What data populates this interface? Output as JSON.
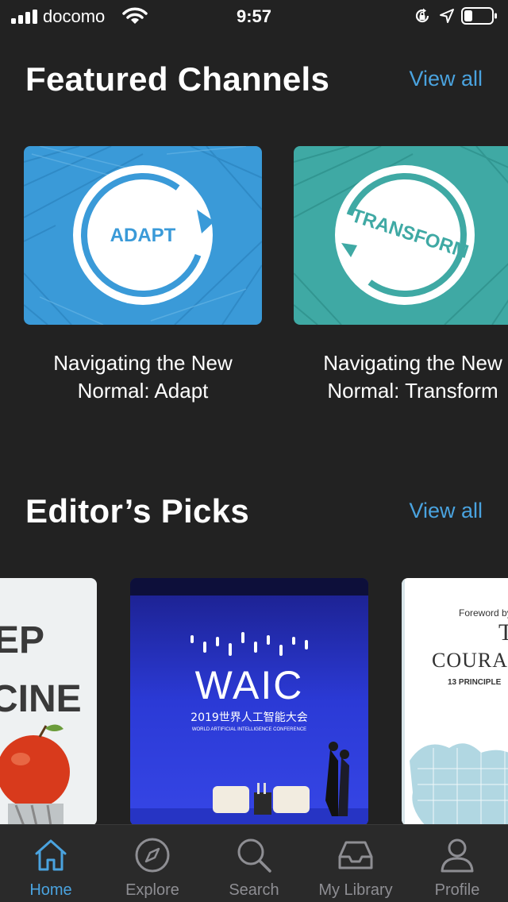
{
  "status_bar": {
    "carrier": "docomo",
    "time": "9:57"
  },
  "featured": {
    "title": "Featured Channels",
    "view_all": "View all",
    "cards": [
      {
        "badge": "ADAPT",
        "title_line1": "Navigating the New",
        "title_line2": "Normal: Adapt",
        "color": "#3a9ad8"
      },
      {
        "badge": "TRANSFORM",
        "title_line1": "Navigating the New",
        "title_line2": "Normal: Transform",
        "color": "#3fa9a4"
      }
    ]
  },
  "editors_picks": {
    "title": "Editor’s Picks",
    "view_all": "View all",
    "items": [
      {
        "visible_text_1": "EP",
        "visible_text_2": "CINE"
      },
      {
        "logo": "WAIC",
        "subtitle": "2019世界人工智能大会",
        "caption": "WORLD ARTIFICIAL INTELLIGENCE CONFERENCE"
      },
      {
        "foreword": "Foreword by",
        "letter": "T",
        "word": "COURA",
        "sub": "13 PRINCIPLE"
      }
    ]
  },
  "tabs": [
    {
      "label": "Home",
      "icon": "home-icon",
      "active": true
    },
    {
      "label": "Explore",
      "icon": "compass-icon",
      "active": false
    },
    {
      "label": "Search",
      "icon": "search-icon",
      "active": false
    },
    {
      "label": "My Library",
      "icon": "inbox-icon",
      "active": false
    },
    {
      "label": "Profile",
      "icon": "person-icon",
      "active": false
    }
  ],
  "colors": {
    "background": "#222222",
    "accent": "#4aa3df",
    "tab_inactive": "#8e8e93"
  }
}
